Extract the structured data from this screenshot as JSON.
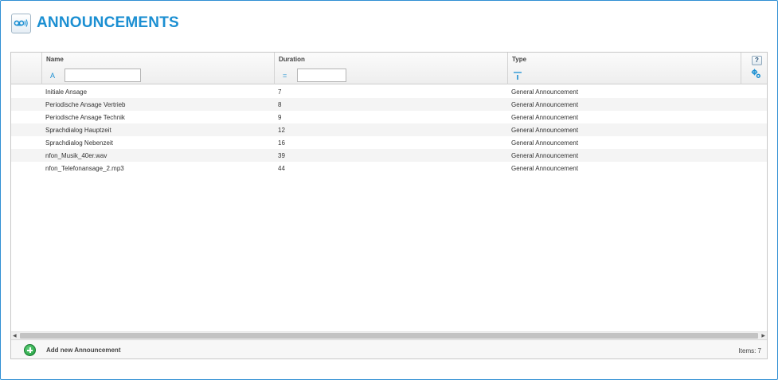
{
  "page": {
    "title": "ANNOUNCEMENTS",
    "icon": "voicemail-icon"
  },
  "grid": {
    "columns": [
      {
        "key": "name",
        "label": "Name",
        "filter_icon": "A"
      },
      {
        "key": "duration",
        "label": "Duration",
        "filter_icon": "="
      },
      {
        "key": "type",
        "label": "Type",
        "filter_icon": "filter-icon"
      }
    ],
    "filters": {
      "name_value": "",
      "duration_value": ""
    },
    "help_label": "?",
    "rows": [
      {
        "name": "Initiale Ansage",
        "duration": "7",
        "type": "General Announcement"
      },
      {
        "name": "Periodische Ansage Vertrieb",
        "duration": "8",
        "type": "General Announcement"
      },
      {
        "name": "Periodische Ansage Technik",
        "duration": "9",
        "type": "General Announcement"
      },
      {
        "name": "Sprachdialog Hauptzeit",
        "duration": "12",
        "type": "General Announcement"
      },
      {
        "name": "Sprachdialog Nebenzeit",
        "duration": "16",
        "type": "General Announcement"
      },
      {
        "name": "nfon_Musik_40er.wav",
        "duration": "39",
        "type": "General Announcement"
      },
      {
        "name": "nfon_Telefonansage_2.mp3",
        "duration": "44",
        "type": "General Announcement"
      }
    ]
  },
  "footer": {
    "add_label": "Add new Announcement",
    "items_count": "Items: 7"
  },
  "colors": {
    "accent": "#1b8fd2",
    "add_green": "#1f9a3c",
    "border": "#2f8fd4"
  }
}
